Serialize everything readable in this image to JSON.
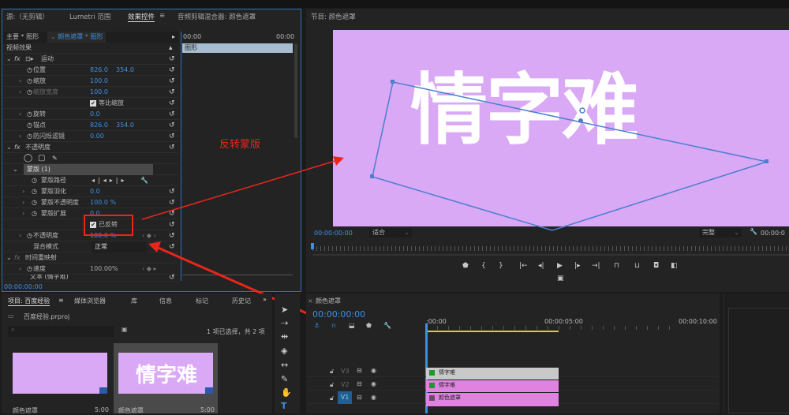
{
  "effect_controls": {
    "tabs": [
      "源:（无剪辑）",
      "Lumetri 范围",
      "效果控件",
      "音频剪辑混合器: 颜色遮罩"
    ],
    "tab_menu": "≡",
    "master": "主要 * 图形",
    "clip_select": "颜色遮罩 * 图形",
    "time_start": "00:00",
    "time_end": "00:00",
    "track_clip": "图形",
    "video_effects": "视频效果",
    "motion": "运动",
    "position": "位置",
    "position_x": "826.0",
    "position_y": "354.0",
    "scale": "缩放",
    "scale_val": "100.0",
    "scale_width": "缩放宽度",
    "scale_width_val": "100.0",
    "uniform_scale": "等比缩放",
    "rotation": "旋转",
    "rotation_val": "0.0",
    "anchor": "锚点",
    "anchor_x": "826.0",
    "anchor_y": "354.0",
    "anti_flicker": "防闪烁滤镜",
    "anti_flicker_val": "0.00",
    "opacity_group": "不透明度",
    "mask": "蒙版 (1)",
    "mask_path": "蒙版路径",
    "mask_feather": "蒙版羽化",
    "mask_feather_val": "0.0",
    "mask_opacity": "蒙版不透明度",
    "mask_opacity_val": "100.0 %",
    "mask_expansion": "蒙版扩展",
    "mask_expansion_val": "0.0",
    "inverted": "已反转",
    "opacity": "不透明度",
    "opacity_val": "100.0 %",
    "blend_mode": "混合模式",
    "blend_mode_val": "正常",
    "time_remap": "时间重映射",
    "speed": "速度",
    "speed_val": "100.00%",
    "text_layer": "文本 (情字难)",
    "timecode": "00:00:00:00"
  },
  "annotation": {
    "label": "反转蒙版",
    "color": "#e8261c"
  },
  "program": {
    "title": "节目: 颜色遮罩",
    "frame_text": "情字难",
    "frame_color": "#d9a9f5",
    "timecode": "00:00:00:00",
    "fit": "适合",
    "quality": "完整",
    "timecode_right": "00:00:0"
  },
  "project": {
    "tabs": [
      "项目: 百度经验",
      "媒体浏览器",
      "库",
      "信息",
      "标记",
      "历史记"
    ],
    "tab_menu": "≡",
    "more": "»",
    "file": "百度经验.prproj",
    "selection": "1 项已选择，共 2 项",
    "items": [
      {
        "name": "颜色遮罩",
        "duration": "5:00",
        "thumb_text": ""
      },
      {
        "name": "颜色遮罩",
        "duration": "5:00",
        "thumb_text": "情字难"
      }
    ]
  },
  "timeline": {
    "title": "颜色遮罩",
    "timecode": "00:00:00:00",
    "ruler": [
      ":00:00",
      "00:00:05:00",
      "00:00:10:00"
    ],
    "tracks": [
      {
        "name": "V3",
        "clip": "情字难"
      },
      {
        "name": "V2",
        "clip": "情字难"
      },
      {
        "name": "V1",
        "clip": "颜色遮罩"
      }
    ]
  }
}
